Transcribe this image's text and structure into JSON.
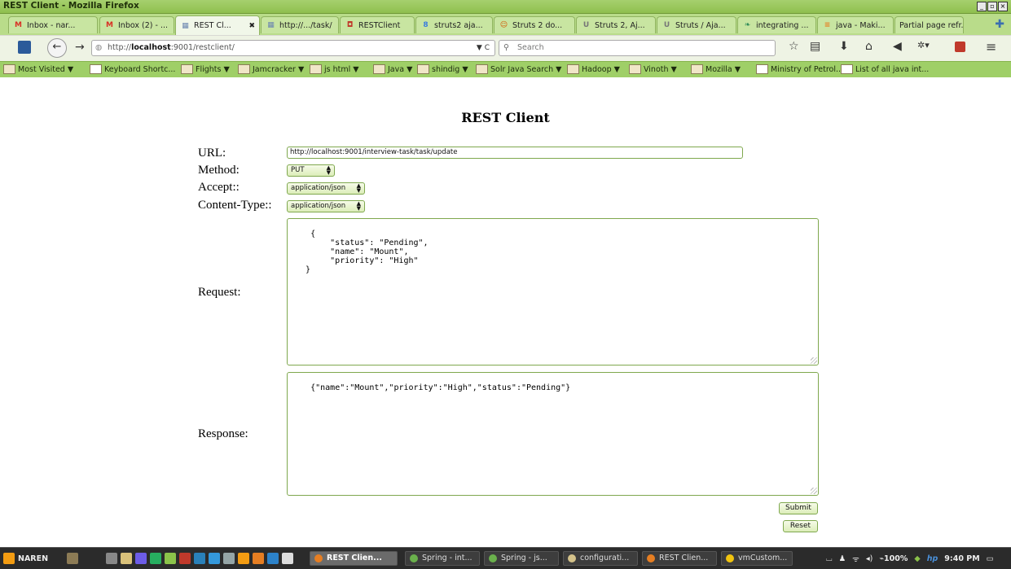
{
  "window": {
    "title": "REST Client - Mozilla Firefox",
    "controls": [
      "_",
      "▫",
      "×"
    ]
  },
  "tabs": [
    {
      "label": "Inbox - nar...",
      "icon": "gmail-icon",
      "icon_char": "M",
      "color": "#d93025"
    },
    {
      "label": "Inbox (2) - ...",
      "icon": "gmail-icon",
      "icon_char": "M",
      "color": "#d93025"
    },
    {
      "label": "REST Cl...",
      "icon": "page-icon",
      "icon_char": "▦",
      "color": "#6b86b0",
      "active": true
    },
    {
      "label": "http://.../task/",
      "icon": "page-icon",
      "icon_char": "▦",
      "color": "#6b86b0"
    },
    {
      "label": "RESTClient",
      "icon": "restclient-icon",
      "icon_char": "◘",
      "color": "#c0392b"
    },
    {
      "label": "struts2 aja...",
      "icon": "google-icon",
      "icon_char": "8",
      "color": "#3b7ddd"
    },
    {
      "label": "Struts 2 do...",
      "icon": "struts-icon",
      "icon_char": "☺",
      "color": "#d35400"
    },
    {
      "label": "Struts 2, Aj...",
      "icon": "stackoverflow-icon",
      "icon_char": "U",
      "color": "#777"
    },
    {
      "label": "Struts / Aja...",
      "icon": "stackoverflow-icon",
      "icon_char": "U",
      "color": "#777"
    },
    {
      "label": "integrating ...",
      "icon": "leaf-icon",
      "icon_char": "❧",
      "color": "#2e8b57"
    },
    {
      "label": "java - Maki...",
      "icon": "stackoverflow-icon",
      "icon_char": "≡",
      "color": "#e67e22"
    },
    {
      "label": "Partial page refr...",
      "icon": "",
      "icon_char": "",
      "color": "#333"
    }
  ],
  "nav": {
    "url_prefix": "http://",
    "url_host": "localhost",
    "url_rest": ":9001/restclient/",
    "url_icons": "▼ C",
    "search_placeholder": "Search"
  },
  "bookmarks": [
    {
      "label": "Most Visited ▼",
      "kind": "folder"
    },
    {
      "label": "Keyboard Shortc...",
      "kind": "link"
    },
    {
      "label": "Flights ▼",
      "kind": "folder"
    },
    {
      "label": "Jamcracker ▼",
      "kind": "folder"
    },
    {
      "label": "js html ▼",
      "kind": "folder"
    },
    {
      "label": "Java ▼",
      "kind": "folder"
    },
    {
      "label": "shindig ▼",
      "kind": "folder"
    },
    {
      "label": "Solr Java Search ▼",
      "kind": "folder"
    },
    {
      "label": "Hadoop ▼",
      "kind": "folder"
    },
    {
      "label": "Vinoth ▼",
      "kind": "folder"
    },
    {
      "label": "Mozilla ▼",
      "kind": "folder"
    },
    {
      "label": "Ministry of Petrol...",
      "kind": "link"
    },
    {
      "label": "List of all java int...",
      "kind": "link"
    }
  ],
  "page": {
    "title": "REST Client",
    "labels": {
      "url": "URL:",
      "method": "Method:",
      "accept": "Accept::",
      "content_type": "Content-Type::",
      "request": "Request:",
      "response": "Response:"
    },
    "url_value": "http://localhost:9001/interview-task/task/update",
    "method_value": "PUT",
    "accept_value": "application/json",
    "content_type_value": "application/json",
    "request_body": "{\n        \"status\": \"Pending\",\n        \"name\": \"Mount\",\n        \"priority\": \"High\"\n   }",
    "response_body": "{\"name\":\"Mount\",\"priority\":\"High\",\"status\":\"Pending\"}",
    "submit_label": "Submit",
    "reset_label": "Reset"
  },
  "taskbar": {
    "user": "NAREN",
    "apps": [
      {
        "label": "REST Clien...",
        "active": true,
        "color": "#e67e22"
      },
      {
        "label": "Spring - int...",
        "active": false,
        "color": "#6ab04c"
      },
      {
        "label": "Spring - js...",
        "active": false,
        "color": "#6ab04c"
      },
      {
        "label": "configurati...",
        "active": false,
        "color": "#d4c28a"
      },
      {
        "label": "REST Clien...",
        "active": false,
        "color": "#e67e22"
      },
      {
        "label": "vmCustom...",
        "active": false,
        "color": "#f1c40f"
      }
    ],
    "battery": "100%",
    "time": "9:40 PM"
  }
}
